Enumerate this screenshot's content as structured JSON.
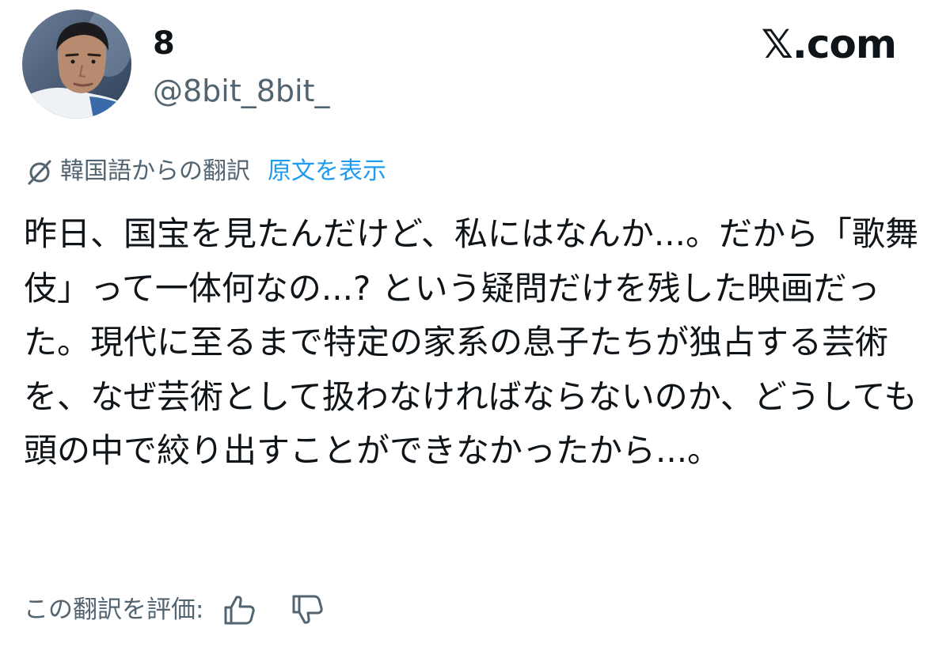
{
  "author": {
    "display_name": "8",
    "handle": "@8bit_8bit_"
  },
  "brand": {
    "label": "𝕏.com"
  },
  "translation": {
    "icon": "translate-globe-icon",
    "translated_from": "韓国語からの翻訳",
    "show_original": "原文を表示"
  },
  "tweet": {
    "text": "昨日、国宝を見たんだけど、私にはなんか...。だから「歌舞伎」って一体何なの...? という疑問だけを残した映画だった。現代に至るまで特定の家系の息子たちが独占する芸術を、なぜ芸術として扱わなければならないのか、どうしても頭の中で絞り出すことができなかったから...。"
  },
  "rating": {
    "label": "この翻訳を評価:",
    "like_icon": "thumbs-up-icon",
    "dislike_icon": "thumbs-down-icon"
  },
  "colors": {
    "text_primary": "#0f1419",
    "text_secondary": "#536471",
    "link": "#1d9bf0"
  }
}
